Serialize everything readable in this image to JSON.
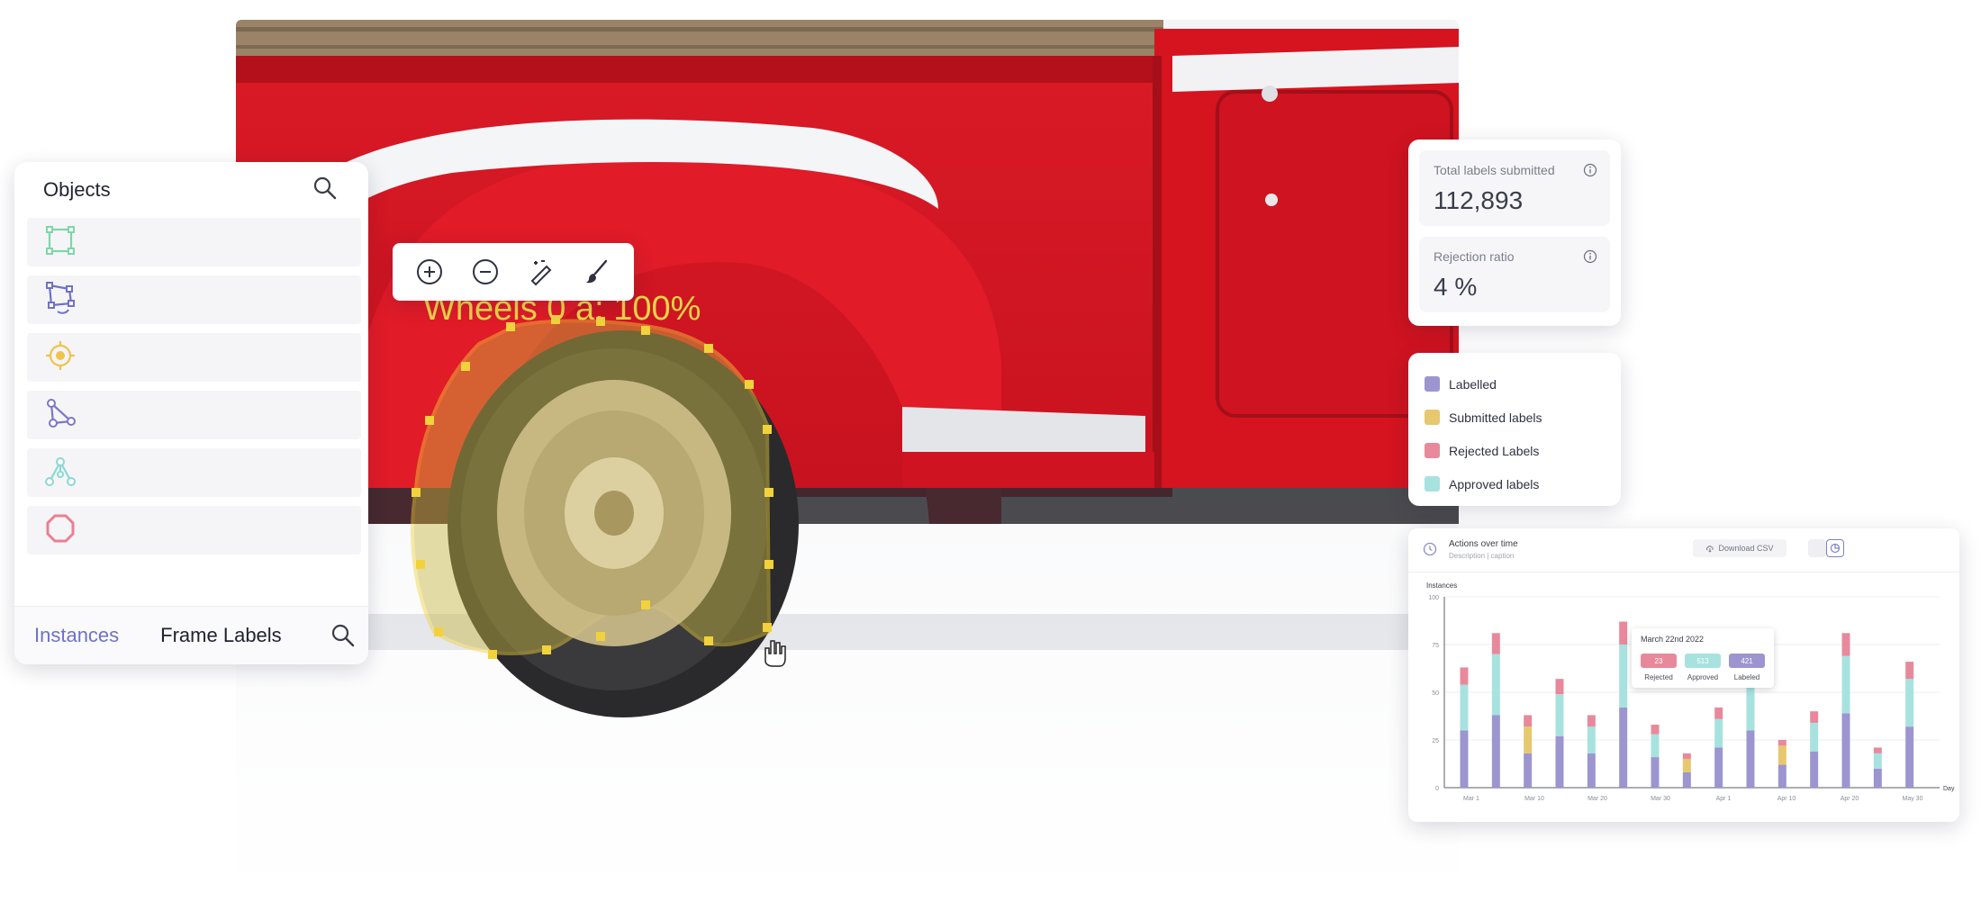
{
  "canvas": {
    "annotation_label": "Wheels 0 a: 100%"
  },
  "objects_panel": {
    "title": "Objects",
    "items": [
      {
        "icon": "bounding-box-icon",
        "color": "#7fd6a8"
      },
      {
        "icon": "polygon-rotate-icon",
        "color": "#6f71c9"
      },
      {
        "icon": "point-target-icon",
        "color": "#f0c24c"
      },
      {
        "icon": "polyline-icon",
        "color": "#7e76c8"
      },
      {
        "icon": "skeleton-icon",
        "color": "#8ad8d4"
      },
      {
        "icon": "octagon-icon",
        "color": "#ea7f93"
      }
    ],
    "tabs": [
      "Instances",
      "Frame Labels"
    ]
  },
  "toolbar": {
    "tools": [
      "zoom-in-icon",
      "zoom-out-icon",
      "magic-pen-icon",
      "brush-icon"
    ]
  },
  "stats": {
    "total_label": "Total labels submitted",
    "total_value": "112,893",
    "rejection_label": "Rejection ratio",
    "rejection_value": "4 %"
  },
  "legend": [
    {
      "label": "Labelled",
      "color": "#9d95cf"
    },
    {
      "label": "Submitted labels",
      "color": "#e6c86f"
    },
    {
      "label": "Rejected Labels",
      "color": "#e8899b"
    },
    {
      "label": "Approved labels",
      "color": "#a7e2df"
    }
  ],
  "chart_card": {
    "title": "Actions over time",
    "subtitle": "Description | caption",
    "download_label": "Download CSV"
  },
  "chart_data": {
    "type": "bar",
    "stacked": true,
    "ylabel": "Instances",
    "xlabel": "Day",
    "ylim": [
      0,
      100
    ],
    "yticks": [
      0,
      25,
      50,
      75,
      100
    ],
    "x_tick_labels": [
      "Mar 1",
      "Mar 10",
      "Mar 20",
      "Mar 30",
      "Apr 1",
      "Apr 10",
      "Apr 20",
      "May 30"
    ],
    "categories": [
      "b1",
      "b2",
      "b3",
      "b4",
      "b5",
      "b6",
      "b7",
      "b8",
      "b9",
      "b10",
      "b11",
      "b12",
      "b13",
      "b14",
      "b15",
      "b16",
      "b17",
      "b18",
      "b19",
      "b20"
    ],
    "series": [
      {
        "name": "Labelled",
        "color": "#9d95cf",
        "values": [
          30,
          38,
          18,
          27,
          18,
          42,
          16,
          8,
          21,
          30,
          12,
          19,
          39,
          10,
          32,
          0,
          0,
          0,
          0,
          0
        ]
      },
      {
        "name": "Submitted labels",
        "color": "#e6c86f",
        "values": [
          0,
          0,
          14,
          0,
          0,
          0,
          0,
          7,
          0,
          0,
          10,
          0,
          0,
          0,
          0,
          0,
          0,
          0,
          0,
          0
        ]
      },
      {
        "name": "Approved labels",
        "color": "#a7e2df",
        "values": [
          24,
          32,
          0,
          22,
          14,
          33,
          12,
          0,
          15,
          35,
          0,
          15,
          30,
          8,
          25,
          0,
          0,
          0,
          0,
          0
        ]
      },
      {
        "name": "Rejected Labels",
        "color": "#e8899b",
        "values": [
          9,
          11,
          6,
          8,
          6,
          12,
          5,
          3,
          6,
          0,
          3,
          6,
          12,
          3,
          9,
          0,
          0,
          0,
          0,
          0
        ]
      }
    ],
    "tooltip": {
      "title": "March 22nd 2022",
      "items": [
        {
          "value": "23",
          "label": "Rejected",
          "color": "#e8899b"
        },
        {
          "value": "513",
          "label": "Approved",
          "color": "#a7e2df"
        },
        {
          "value": "421",
          "label": "Labeled",
          "color": "#9d95cf"
        }
      ]
    }
  }
}
